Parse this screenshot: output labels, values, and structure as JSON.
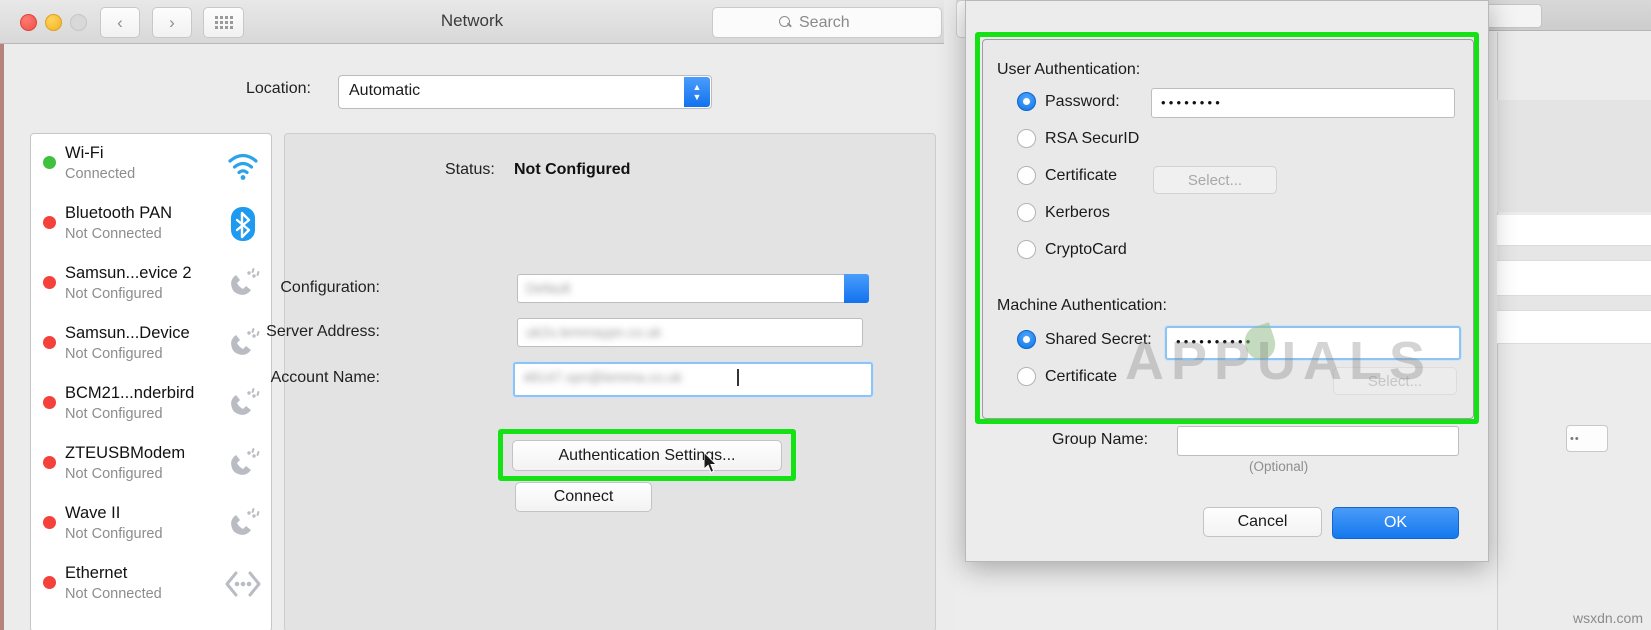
{
  "window": {
    "title": "Network",
    "traffic_lights": [
      "close",
      "minimize",
      "zoom"
    ],
    "nav_back": "‹",
    "nav_forward": "›",
    "grid_button": "show-all-grid",
    "search_placeholder": "Search"
  },
  "location": {
    "label": "Location:",
    "value": "Automatic"
  },
  "sidebar": {
    "items": [
      {
        "name": "Wi-Fi",
        "status": "Connected",
        "dot": "green",
        "icon": "wifi-icon"
      },
      {
        "name": "Bluetooth PAN",
        "status": "Not Connected",
        "dot": "red",
        "icon": "bluetooth-icon"
      },
      {
        "name": "Samsun...evice 2",
        "status": "Not Configured",
        "dot": "red",
        "icon": "modem-icon"
      },
      {
        "name": "Samsun...Device",
        "status": "Not Configured",
        "dot": "red",
        "icon": "modem-icon"
      },
      {
        "name": "BCM21...nderbird",
        "status": "Not Configured",
        "dot": "red",
        "icon": "modem-icon"
      },
      {
        "name": "ZTEUSBModem",
        "status": "Not Configured",
        "dot": "red",
        "icon": "modem-icon"
      },
      {
        "name": "Wave II",
        "status": "Not Configured",
        "dot": "red",
        "icon": "modem-icon"
      },
      {
        "name": "Ethernet",
        "status": "Not Connected",
        "dot": "red",
        "icon": "ethernet-icon"
      }
    ]
  },
  "panel": {
    "status_label": "Status:",
    "status_value": "Not Configured",
    "fields": [
      {
        "label": "Configuration:",
        "value": "Default",
        "redacted": true,
        "stepper": true,
        "focused": false
      },
      {
        "label": "Server Address:",
        "value": "uk2s.lemmaypn.co.uk",
        "redacted": true,
        "stepper": false,
        "focused": false
      },
      {
        "label": "Account Name:",
        "value": "48147.vpn@lemma.co.uk",
        "redacted": true,
        "stepper": false,
        "focused": true
      }
    ],
    "auth_button": "Authentication Settings...",
    "connect_button": "Connect"
  },
  "dialog": {
    "user_auth_title": "User Authentication:",
    "user_options": [
      {
        "label": "Password:",
        "selected": true,
        "has_field": true,
        "field_value": "••••••••",
        "has_select": false
      },
      {
        "label": "RSA SecurID",
        "selected": false,
        "has_field": false,
        "field_value": "",
        "has_select": false
      },
      {
        "label": "Certificate",
        "selected": false,
        "has_field": false,
        "field_value": "",
        "has_select": true,
        "select_label": "Select..."
      },
      {
        "label": "Kerberos",
        "selected": false,
        "has_field": false,
        "field_value": "",
        "has_select": false
      },
      {
        "label": "CryptoCard",
        "selected": false,
        "has_field": false,
        "field_value": "",
        "has_select": false
      }
    ],
    "machine_auth_title": "Machine Authentication:",
    "machine_options": [
      {
        "label": "Shared Secret:",
        "selected": true,
        "has_field": true,
        "field_value": "••••••••••",
        "has_select": false
      },
      {
        "label": "Certificate",
        "selected": false,
        "has_field": false,
        "field_value": "",
        "has_select": true,
        "select_label": "Select..."
      }
    ],
    "group_label": "Group Name:",
    "group_value": "",
    "group_note": "(Optional)",
    "cancel_button": "Cancel",
    "ok_button": "OK"
  },
  "overlay": {
    "watermark": "APPUALS",
    "site": "wsxdn.com",
    "highlight_color": "#14e214"
  }
}
